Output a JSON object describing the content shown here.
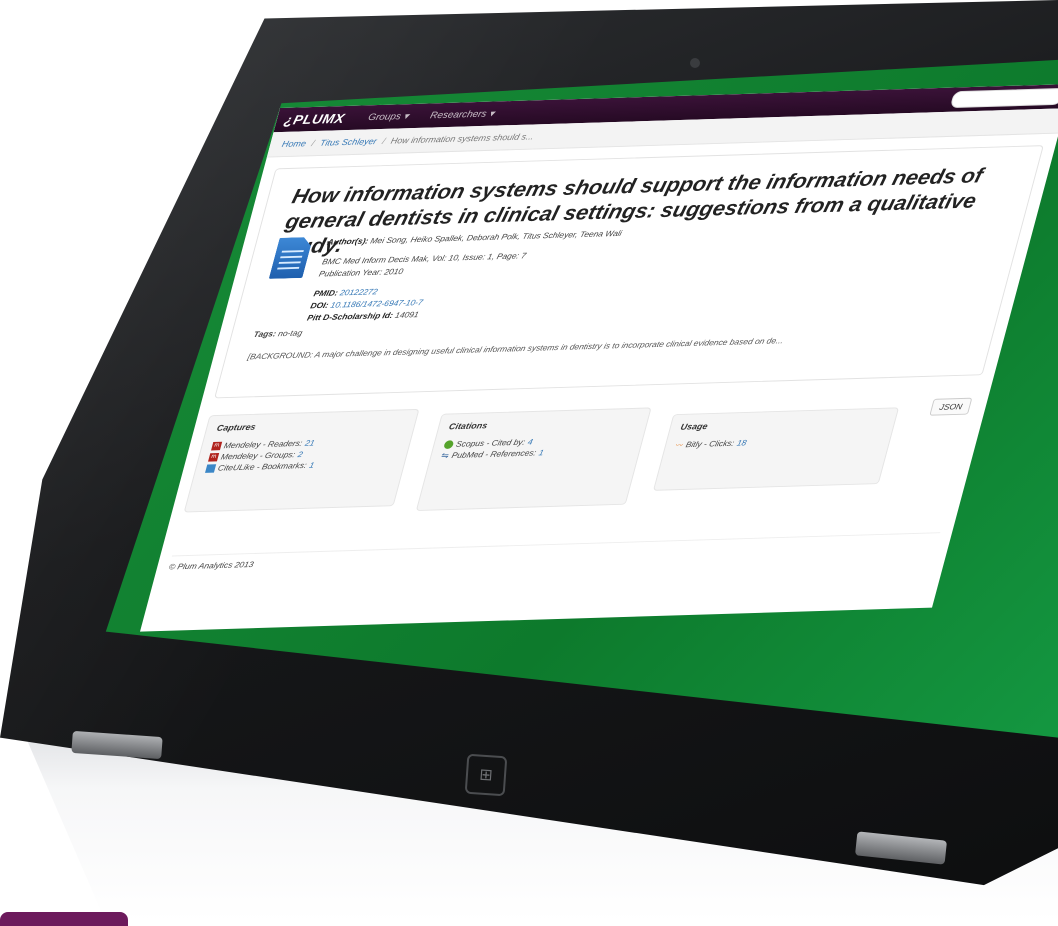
{
  "navbar": {
    "logo": "¿PLUMX",
    "items": [
      {
        "label": "Groups"
      },
      {
        "label": "Researchers"
      }
    ]
  },
  "breadcrumb": {
    "home": "Home",
    "researcher": "Titus Schleyer",
    "current": "How information systems should s..."
  },
  "article": {
    "title": "How information systems should support the information needs of general dentists in clinical settings: suggestions from a qualitative study.",
    "authors_label": "Author(s):",
    "authors": "Mei Song, Heiko Spallek, Deborah Polk, Titus Schleyer, Teena Wali",
    "journal": "BMC Med Inform Decis Mak, Vol: 10, Issue: 1, Page: 7",
    "year": "Publication Year: 2010",
    "pmid_label": "PMID:",
    "pmid": "20122272",
    "doi_label": "DOI:",
    "doi": "10.1186/1472-6947-10-7",
    "dscholarship_label": "Pitt D-Scholarship Id:",
    "dscholarship": "14091",
    "tags_label": "Tags:",
    "tags": "no-tag",
    "abstract": "[BACKGROUND: A major challenge in designing useful clinical information systems in dentistry is to incorporate clinical evidence based on de..."
  },
  "captures": {
    "title": "Captures",
    "rows": [
      {
        "label": "Mendeley - Readers:",
        "value": "21",
        "icon": "mendeley-icon"
      },
      {
        "label": "Mendeley - Groups:",
        "value": "2",
        "icon": "mendeley-icon"
      },
      {
        "label": "CiteULike - Bookmarks:",
        "value": "1",
        "icon": "citeulike-icon"
      }
    ]
  },
  "citations": {
    "title": "Citations",
    "rows": [
      {
        "label": "Scopus - Cited by:",
        "value": "4",
        "icon": "scopus-icon"
      },
      {
        "label": "PubMed - References:",
        "value": "1",
        "icon": "pubmed-icon"
      }
    ]
  },
  "usage": {
    "title": "Usage",
    "rows": [
      {
        "label": "Bitly - Clicks:",
        "value": "18",
        "icon": "bitly-icon"
      }
    ]
  },
  "json_button": "JSON",
  "footer": "© Plum Analytics 2013",
  "colors": {
    "brand": "#3a1238",
    "link": "#3477b5",
    "bezel_green": "#0d7a2c"
  }
}
